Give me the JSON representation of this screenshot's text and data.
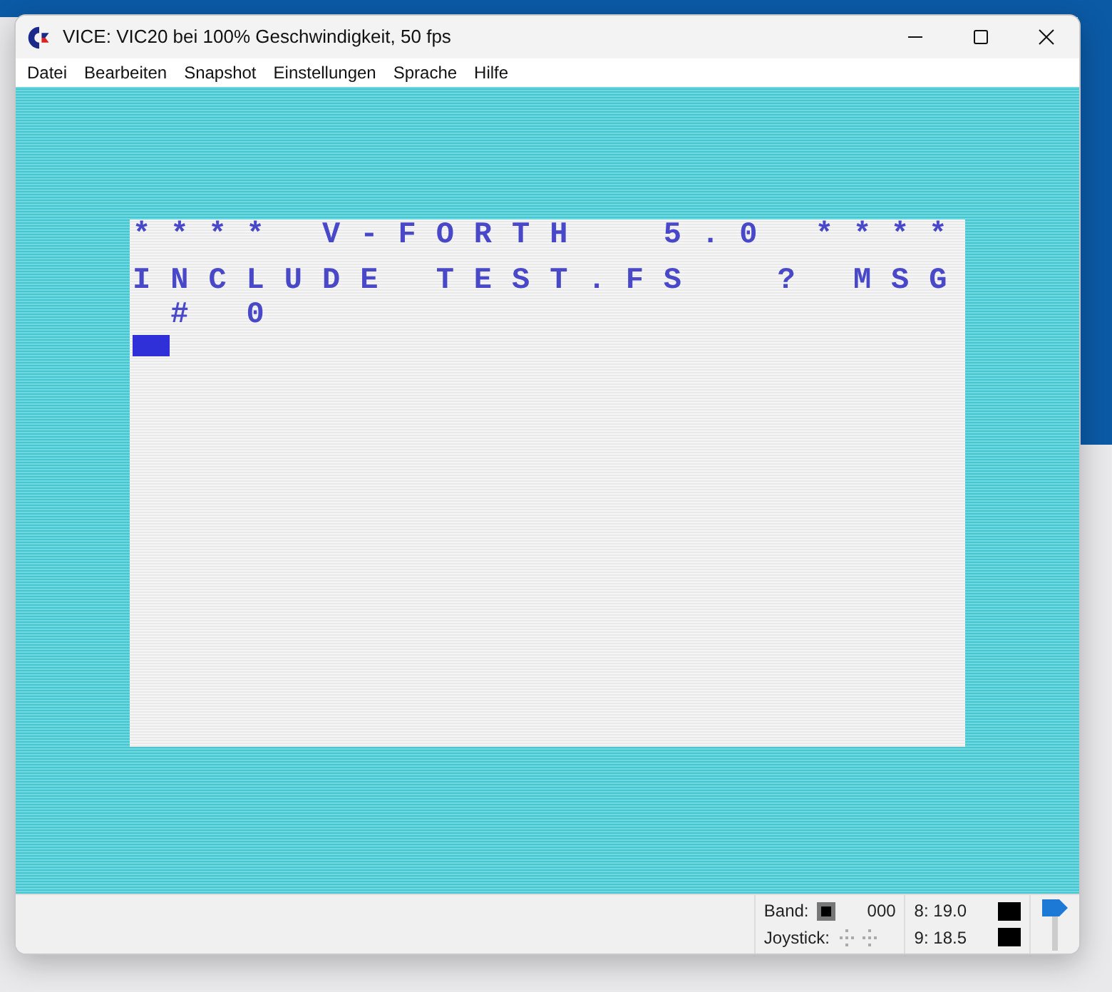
{
  "window": {
    "title": "VICE: VIC20 bei 100% Geschwindigkeit, 50 fps"
  },
  "menu": [
    "Datei",
    "Bearbeiten",
    "Snapshot",
    "Einstellungen",
    "Sprache",
    "Hilfe"
  ],
  "screen": {
    "lines": [
      {
        "kind": "banner",
        "text": "**** V-FORTH  5.0 ****"
      },
      {
        "kind": "text",
        "text": "INCLUDE TEST.FS  ? MSG"
      },
      {
        "kind": "text",
        "text": " # 0"
      }
    ],
    "cursor_visible": true
  },
  "status_bar": {
    "tape_label": "Band:",
    "tape_counter": "000",
    "joystick_label": "Joystick:",
    "drives": [
      {
        "label": "8: 19.0"
      },
      {
        "label": "9: 18.5"
      }
    ],
    "volume": {
      "level": 1
    }
  }
}
